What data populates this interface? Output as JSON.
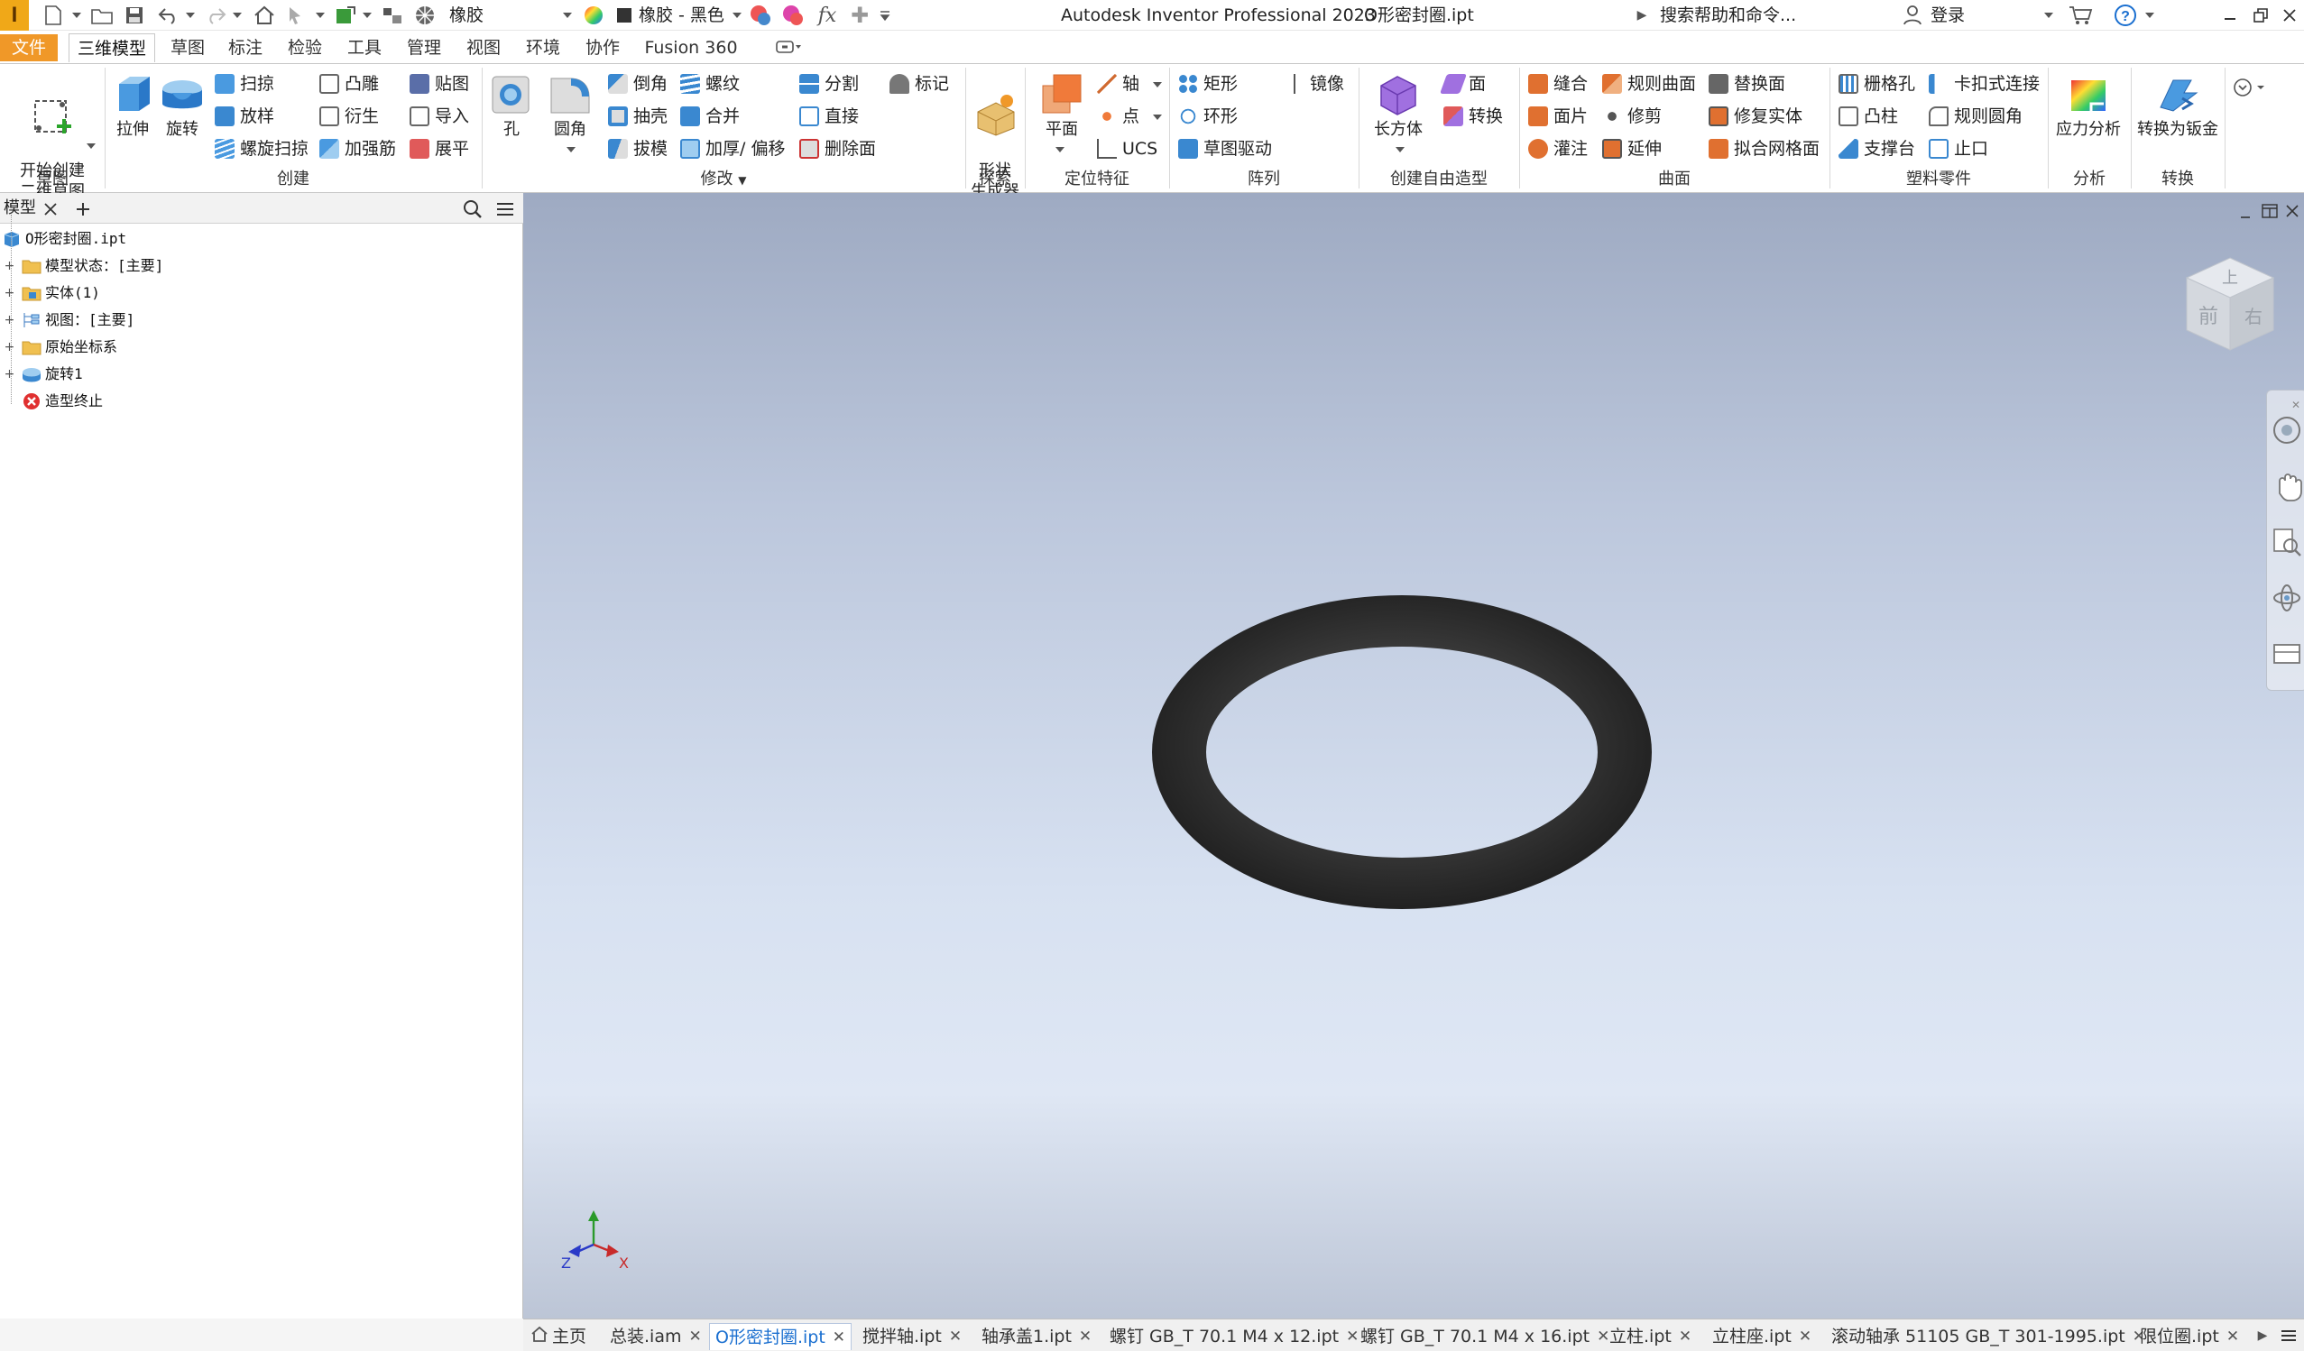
{
  "app": {
    "title": "Autodesk Inventor Professional 2023",
    "document": "O形密封圈.ipt",
    "logo_letter": "I"
  },
  "quick_access": {
    "material": "橡胶",
    "appearance": "橡胶 - 黑色",
    "search_placeholder": "搜索帮助和命令...",
    "login": "登录",
    "fx_label": "fx"
  },
  "menu_tabs": [
    {
      "label": "文件"
    },
    {
      "label": "三维模型"
    },
    {
      "label": "草图"
    },
    {
      "label": "标注"
    },
    {
      "label": "检验"
    },
    {
      "label": "工具"
    },
    {
      "label": "管理"
    },
    {
      "label": "视图"
    },
    {
      "label": "环境"
    },
    {
      "label": "协作"
    },
    {
      "label": "Fusion 360"
    }
  ],
  "ribbon": {
    "sketch": {
      "title": "草图",
      "start": "开始创建\n二维草图"
    },
    "create": {
      "title": "创建",
      "extrude": "拉伸",
      "revolve": "旋转",
      "sweep": "扫掠",
      "loft": "放样",
      "coil": "螺旋扫掠",
      "emboss": "凸雕",
      "derive": "衍生",
      "rib": "加强筋",
      "decal": "贴图",
      "import": "导入",
      "unfold": "展平"
    },
    "modify": {
      "title": "修改",
      "hole": "孔",
      "fillet": "圆角",
      "chamfer": "倒角",
      "shell": "抽壳",
      "draft": "拔模",
      "thread": "螺纹",
      "combine": "合并",
      "thicken": "加厚/ 偏移",
      "split": "分割",
      "direct": "直接",
      "delete_face": "删除面",
      "mark": "标记"
    },
    "explore": {
      "title": "探索",
      "shape_gen": "形状\n生成器"
    },
    "work_features": {
      "title": "定位特征",
      "plane": "平面",
      "axis": "轴",
      "point": "点",
      "ucs": "UCS"
    },
    "pattern": {
      "title": "阵列",
      "rect": "矩形",
      "circ": "环形",
      "sketch_driven": "草图驱动",
      "mirror": "镜像"
    },
    "freeform": {
      "title": "创建自由造型",
      "box": "长方体",
      "face": "面",
      "convert": "转换"
    },
    "surface": {
      "title": "曲面",
      "stitch": "缝合",
      "patch": "面片",
      "sculpt": "灌注",
      "ruled": "规则曲面",
      "trim": "修剪",
      "extend": "延伸",
      "replace": "替换面",
      "repair": "修复实体",
      "fit_mesh": "拟合网格面"
    },
    "plastic": {
      "title": "塑料零件",
      "grill": "栅格孔",
      "boss": "凸柱",
      "rest": "支撑台",
      "snap": "卡扣式连接",
      "rule_fillet": "规则圆角",
      "lip": "止口"
    },
    "analysis": {
      "title": "分析",
      "stress": "应力分析"
    },
    "convert": {
      "title": "转换",
      "sheet_metal": "转换为钣金"
    }
  },
  "browser": {
    "tab_label": "模型",
    "tree": [
      {
        "label": "O形密封圈.ipt",
        "icon": "part-icon"
      },
      {
        "label": "模型状态：[主要]",
        "icon": "folder-icon"
      },
      {
        "label": "实体(1)",
        "icon": "solid-folder-icon"
      },
      {
        "label": "视图：[主要]",
        "icon": "view-icon"
      },
      {
        "label": "原始坐标系",
        "icon": "folder-icon"
      },
      {
        "label": "旋转1",
        "icon": "revolve-icon"
      },
      {
        "label": "造型终止",
        "icon": "end-of-part-icon"
      }
    ]
  },
  "viewcube": {
    "top": "上",
    "front": "前",
    "right": "右"
  },
  "triad": {
    "x": "X",
    "z": "Z"
  },
  "doc_tabs": [
    {
      "label": "主页"
    },
    {
      "label": "总装.iam"
    },
    {
      "label": "O形密封圈.ipt"
    },
    {
      "label": "搅拌轴.ipt"
    },
    {
      "label": "轴承盖1.ipt"
    },
    {
      "label": "螺钉 GB_T 70.1 M4 x 12.ipt"
    },
    {
      "label": "螺钉 GB_T 70.1 M4 x 16.ipt"
    },
    {
      "label": "立柱.ipt"
    },
    {
      "label": "立柱座.ipt"
    },
    {
      "label": "滚动轴承 51105 GB_T 301-1995.ipt"
    },
    {
      "label": "限位圈.ipt"
    }
  ],
  "colors": {
    "file_tab": "#f09828",
    "active_doc_tab": "#1a6fd0",
    "oring": "#2a2a2a"
  }
}
